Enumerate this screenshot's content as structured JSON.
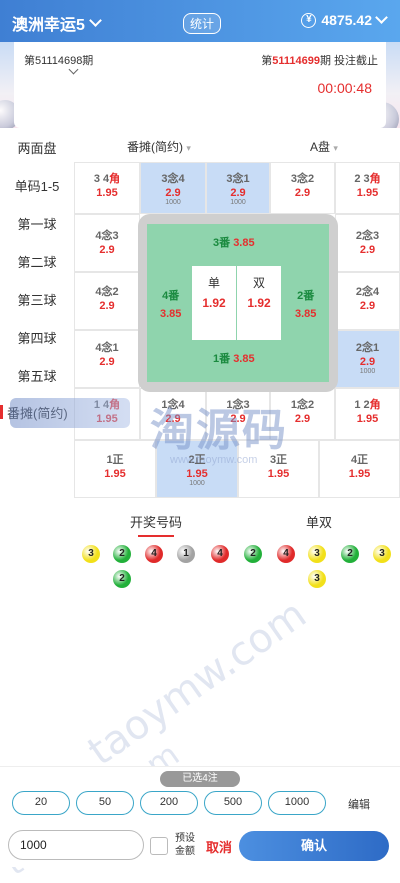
{
  "header": {
    "title": "澳洲幸运5",
    "stats_label": "统计",
    "balance": "4875.42"
  },
  "issue": {
    "prev_label": "第51114698期",
    "next_prefix": "第",
    "next_issue": "51114699",
    "next_suffix": "期 投注截止",
    "countdown": "00:00:48"
  },
  "menu": {
    "items": [
      "两面盘",
      "单码1-5",
      "第一球",
      "第二球",
      "第三球",
      "第四球",
      "第五球"
    ],
    "active": "番摊(简约)"
  },
  "tabs": {
    "left": "番摊(简约)",
    "right": "A盘"
  },
  "grid": {
    "row1": [
      {
        "label": "3 4",
        "jiao": "角",
        "odds": "1.95"
      },
      {
        "label": "3念4",
        "odds": "2.9",
        "stake": "1000"
      },
      {
        "label": "3念1",
        "odds": "2.9",
        "stake": "1000"
      },
      {
        "label": "3念2",
        "odds": "2.9"
      },
      {
        "label": "2 3",
        "jiao": "角",
        "odds": "1.95"
      }
    ],
    "left_col": [
      {
        "label": "4念3",
        "odds": "2.9"
      },
      {
        "label": "4念2",
        "odds": "2.9"
      },
      {
        "label": "4念1",
        "odds": "2.9"
      }
    ],
    "right_col": [
      {
        "label": "2念3",
        "odds": "2.9"
      },
      {
        "label": "2念4",
        "odds": "2.9"
      },
      {
        "label": "2念1",
        "odds": "2.9",
        "stake": "1000"
      }
    ],
    "row5": [
      {
        "label": "1 4",
        "jiao": "角",
        "odds": "1.95"
      },
      {
        "label": "1念4",
        "odds": "2.9"
      },
      {
        "label": "1念3",
        "odds": "2.9"
      },
      {
        "label": "1念2",
        "odds": "2.9"
      },
      {
        "label": "1 2",
        "jiao": "角",
        "odds": "1.95"
      }
    ],
    "row6": [
      {
        "label": "1正",
        "odds": "1.95"
      },
      {
        "label": "2正",
        "odds": "1.95",
        "stake": "1000"
      },
      {
        "label": "3正",
        "odds": "1.95"
      },
      {
        "label": "4正",
        "odds": "1.95"
      }
    ]
  },
  "board": {
    "top": {
      "label": "3番",
      "odds": "3.85"
    },
    "left": {
      "label": "4番",
      "odds": "3.85"
    },
    "right": {
      "label": "2番",
      "odds": "3.85"
    },
    "bottom": {
      "label": "1番",
      "odds": "3.85"
    },
    "dan": {
      "label": "单",
      "odds": "1.92"
    },
    "shuang": {
      "label": "双",
      "odds": "1.92"
    }
  },
  "results_tabs": {
    "left": "开奖号码",
    "right": "单双"
  },
  "balls": [
    {
      "n": "3",
      "color": "#f2e01a"
    },
    {
      "n": "2",
      "color": "#22b03a"
    },
    {
      "n": "4",
      "color": "#e02a2a"
    },
    {
      "n": "1",
      "color": "#a3a3a3"
    },
    {
      "n": "4",
      "color": "#e02a2a"
    },
    {
      "n": "2",
      "color": "#22b03a"
    },
    {
      "n": "4",
      "color": "#e02a2a"
    },
    {
      "n": "3",
      "color": "#f2e01a"
    },
    {
      "n": "2",
      "color": "#22b03a"
    },
    {
      "n": "3",
      "color": "#f2e01a"
    },
    {
      "n": "2",
      "color": "#22b03a"
    },
    {
      "n": "3",
      "color": "#f2e01a"
    }
  ],
  "watermark": {
    "brand": "淘源码",
    "url": "www.taoymw.com",
    "diag": "taoymw.com"
  },
  "bottom": {
    "selected": "已选4注",
    "chips": [
      "20",
      "50",
      "200",
      "500",
      "1000"
    ],
    "edit": "编辑",
    "amount": "1000",
    "preset": "预设金额",
    "cancel": "取消",
    "confirm": "确认"
  }
}
